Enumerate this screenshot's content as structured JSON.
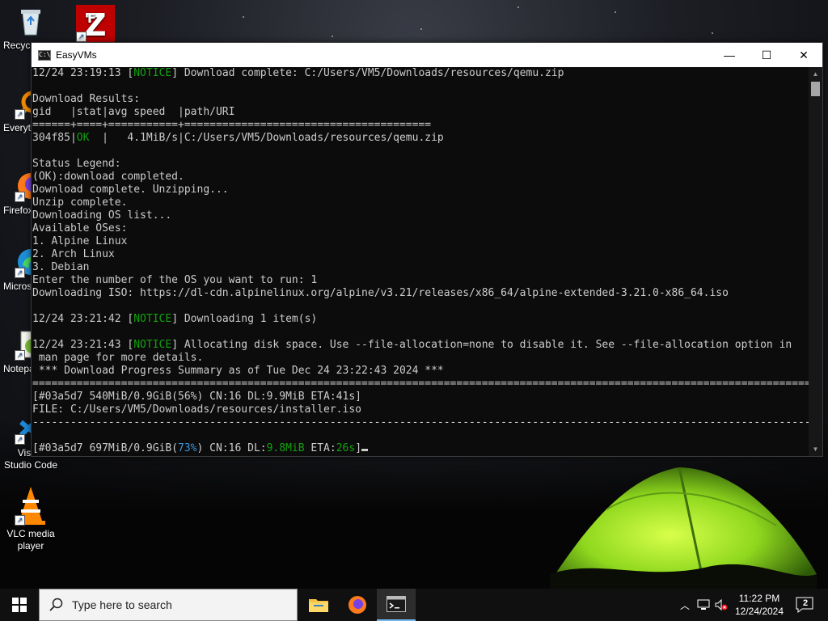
{
  "desktop": {
    "icons": [
      {
        "label": "Recycle Bin",
        "icon": "recycle-bin-icon"
      },
      {
        "label": "FileZilla",
        "icon": "filezilla-icon"
      },
      {
        "label": "Everything",
        "icon": "everything-icon"
      },
      {
        "label": "Firefox",
        "icon": "firefox-icon"
      },
      {
        "label": "Microsoft Edge",
        "icon": "edge-icon"
      },
      {
        "label": "Notepad++",
        "icon": "notepad-plus-plus-icon"
      },
      {
        "label": "Visual Studio Code",
        "icon": "vscode-icon"
      },
      {
        "label": "VLC media player",
        "icon": "vlc-icon"
      }
    ]
  },
  "window": {
    "title": "EasyVMs",
    "minimize": "—",
    "maximize": "☐",
    "close": "✕"
  },
  "terminal": {
    "l01_a": "12/24 23:19:13 [",
    "l01_b": "NOTICE",
    "l01_c": "] Download complete: C:/Users/VM5/Downloads/resources/qemu.zip",
    "l02": "",
    "l03": "Download Results:",
    "l04": "gid   |stat|avg speed  |path/URI",
    "l05": "======+====+===========+=======================================",
    "l06_a": "304f85|",
    "l06_b": "OK",
    "l06_c": "  |   4.1MiB/s|C:/Users/VM5/Downloads/resources/qemu.zip",
    "l07": "",
    "l08": "Status Legend:",
    "l09": "(OK):download completed.",
    "l10": "Download complete. Unzipping...",
    "l11": "Unzip complete.",
    "l12": "Downloading OS list...",
    "l13": "Available OSes:",
    "l14": "1. Alpine Linux",
    "l15": "2. Arch Linux",
    "l16": "3. Debian",
    "l17": "Enter the number of the OS you want to run: 1",
    "l18": "Downloading ISO: https://dl-cdn.alpinelinux.org/alpine/v3.21/releases/x86_64/alpine-extended-3.21.0-x86_64.iso",
    "l19": "",
    "l20_a": "12/24 23:21:42 [",
    "l20_b": "NOTICE",
    "l20_c": "] Downloading 1 item(s)",
    "l21": "",
    "l22_a": "12/24 23:21:43 [",
    "l22_b": "NOTICE",
    "l22_c": "] Allocating disk space. Use --file-allocation=none to disable it. See --file-allocation option in",
    "l23": " man page for more details.",
    "l24": " *** Download Progress Summary as of Tue Dec 24 23:22:43 2024 ***",
    "l25": "===============================================================================================================================",
    "l26": "[#03a5d7 540MiB/0.9GiB(56%) CN:16 DL:9.9MiB ETA:41s]",
    "l27": "FILE: C:/Users/VM5/Downloads/resources/installer.iso",
    "l28": "-------------------------------------------------------------------------------------------------------------------------------",
    "l29": "",
    "l30_a": "[#03a5d7 697MiB/0.9GiB(",
    "l30_b": "73%",
    "l30_c": ") CN:16 DL:",
    "l30_d": "9.8MiB",
    "l30_e": " ETA:",
    "l30_f": "26s",
    "l30_g": "]"
  },
  "taskbar": {
    "search_placeholder": "Type here to search",
    "apps": [
      {
        "name": "File Explorer",
        "icon": "folder-icon"
      },
      {
        "name": "Firefox",
        "icon": "firefox-icon"
      },
      {
        "name": "Terminal",
        "icon": "terminal-icon"
      }
    ],
    "time": "11:22 PM",
    "date": "12/24/2024",
    "notifications": "2"
  },
  "colors": {
    "terminal_bg": "#0c0c0c",
    "terminal_fg": "#cccccc",
    "notice_green": "#13a10e",
    "progress_cyan": "#3a96dd",
    "taskbar_bg": "#101010"
  }
}
